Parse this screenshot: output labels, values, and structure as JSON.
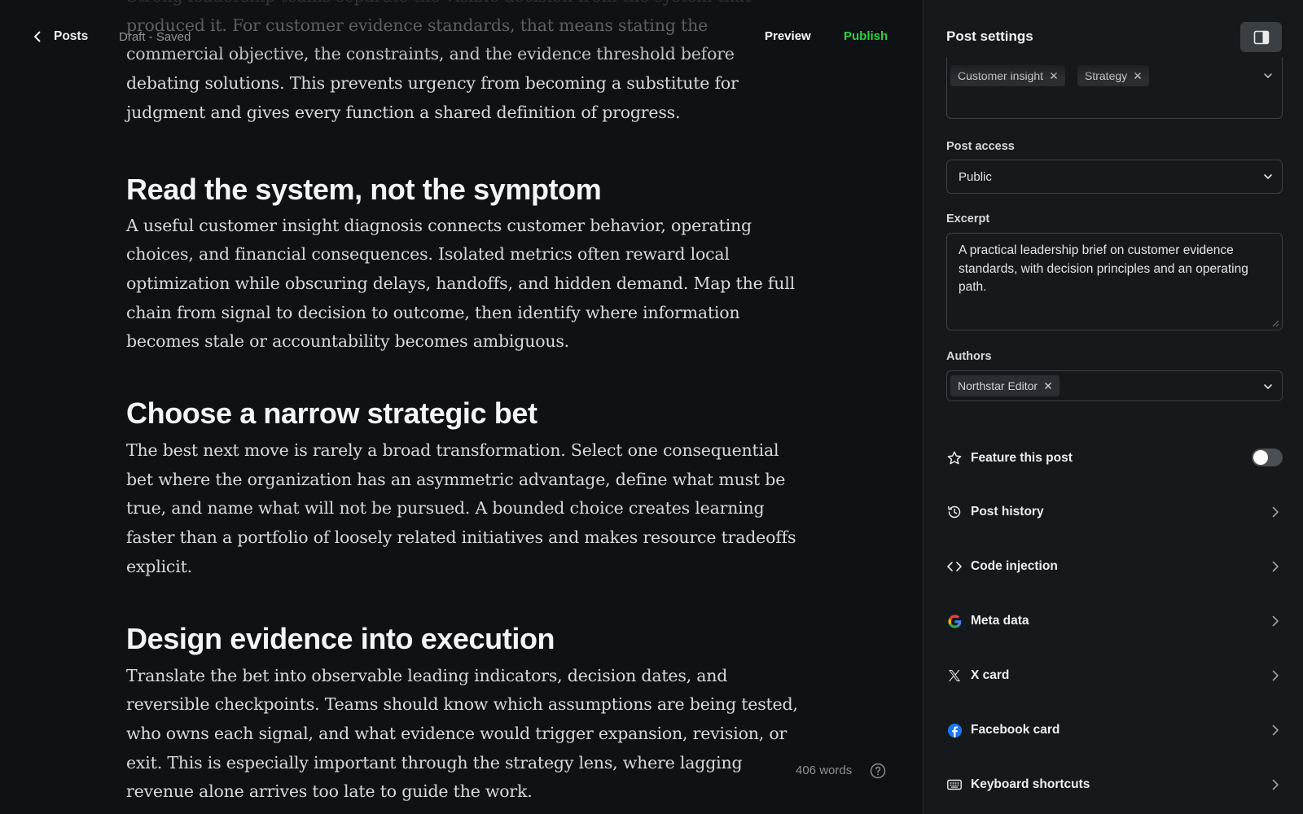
{
  "topbar": {
    "back_label": "Posts",
    "status": "Draft - Saved",
    "preview_label": "Preview",
    "publish_label": "Publish"
  },
  "article": {
    "intro": "Strong leadership teams separate the visible decision from the system that produced it. For customer evidence standards, that means stating the commercial objective, the constraints, and the evidence threshold before debating solutions. This prevents urgency from becoming a substitute for judgment and gives every function a shared definition of progress.",
    "sections": [
      {
        "heading": "Read the system, not the symptom",
        "body": "A useful customer insight diagnosis connects customer behavior, operating choices, and financial consequences. Isolated metrics often reward local optimization while obscuring delays, handoffs, and hidden demand. Map the full chain from signal to decision to outcome, then identify where information becomes stale or accountability becomes ambiguous."
      },
      {
        "heading": "Choose a narrow strategic bet",
        "body": "The best next move is rarely a broad transformation. Select one consequential bet where the organization has an asymmetric advantage, define what must be true, and name what will not be pursued. A bounded choice creates learning faster than a portfolio of loosely related initiatives and makes resource tradeoffs explicit."
      },
      {
        "heading": "Design evidence into execution",
        "body": "Translate the bet into observable leading indicators, decision dates, and reversible checkpoints. Teams should know which assumptions are being tested, who owns each signal, and what evidence would trigger expansion, revision, or exit. This is especially important through the strategy lens, where lagging revenue alone arrives too late to guide the work."
      }
    ]
  },
  "footer": {
    "word_count": "406 words"
  },
  "sidebar": {
    "title": "Post settings",
    "tags": [
      "Customer insight",
      "Strategy"
    ],
    "post_access": {
      "label": "Post access",
      "value": "Public"
    },
    "excerpt": {
      "label": "Excerpt",
      "value": "A practical leadership brief on customer evidence standards, with decision principles and an operating path."
    },
    "authors": {
      "label": "Authors",
      "items": [
        "Northstar Editor"
      ]
    },
    "feature": {
      "label": "Feature this post",
      "enabled": false
    },
    "rows": [
      {
        "label": "Post history",
        "icon": "history-icon"
      },
      {
        "label": "Code injection",
        "icon": "code-icon"
      },
      {
        "label": "Meta data",
        "icon": "google-icon"
      },
      {
        "label": "X card",
        "icon": "x-logo-icon"
      },
      {
        "label": "Facebook card",
        "icon": "facebook-icon"
      },
      {
        "label": "Keyboard shortcuts",
        "icon": "keyboard-icon"
      }
    ]
  },
  "colors": {
    "accent_publish": "#30cf43",
    "background": "#0f1214",
    "sidebar_background": "#16191c",
    "facebook_blue": "#1877f2"
  }
}
